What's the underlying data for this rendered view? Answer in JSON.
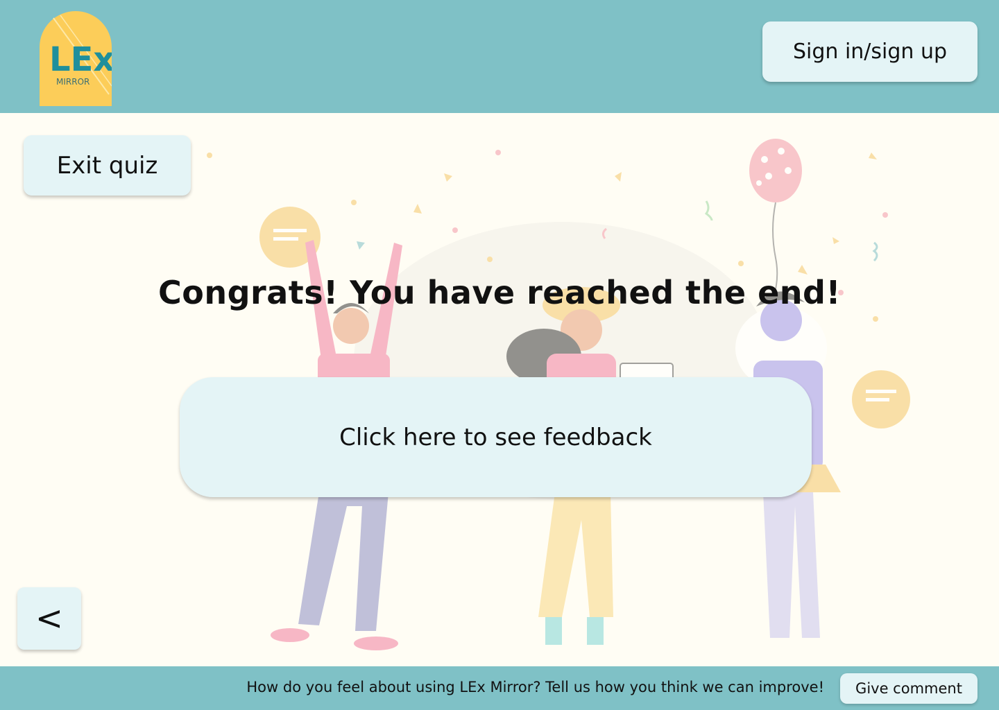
{
  "header": {
    "logo_text_main": "LEx",
    "logo_text_sub": "MIRROR",
    "signin_label": "Sign in/sign up"
  },
  "main": {
    "exit_label": "Exit quiz",
    "headline": "Congrats! You have reached the end!",
    "feedback_label": "Click here to see feedback",
    "back_label": "<"
  },
  "footer": {
    "prompt": "How do you feel about using LEx Mirror? Tell us how you think we can improve!",
    "comment_label": "Give comment"
  },
  "colors": {
    "header_bg": "#7fc1c6",
    "page_bg": "#fffdf4",
    "button_bg": "#e4f4f6",
    "logo_bg": "#fccd59",
    "logo_text": "#1f8f9c"
  }
}
